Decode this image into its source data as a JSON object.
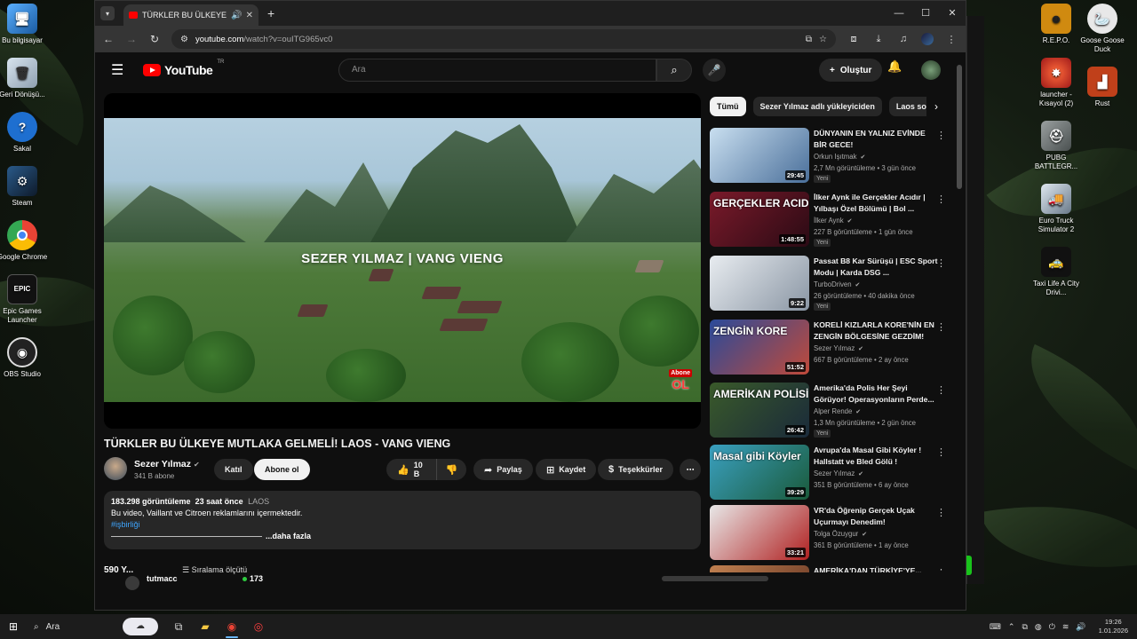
{
  "desktop": {
    "left_icons": [
      {
        "label": "Bu bilgisayar",
        "icon": "computer-icon"
      },
      {
        "label": "Geri Dönüşü...",
        "icon": "recycle-bin-icon"
      },
      {
        "label": "Sakal",
        "icon": "help-icon"
      },
      {
        "label": "Steam",
        "icon": "steam-icon"
      },
      {
        "label": "Google Chrome",
        "icon": "chrome-icon"
      },
      {
        "label": "Epic Games Launcher",
        "icon": "epic-games-icon"
      },
      {
        "label": "OBS Studio",
        "icon": "obs-icon"
      }
    ],
    "right_icons_a": [
      {
        "label": "R.E.P.O.",
        "icon": "repo-icon"
      },
      {
        "label": "launcher - Kısayol (2)",
        "icon": "launcher-icon"
      },
      {
        "label": "PUBG BATTLEGR...",
        "icon": "pubg-icon"
      },
      {
        "label": "Euro Truck Simulator 2",
        "icon": "truck-icon"
      },
      {
        "label": "Taxi Life A City Drivi...",
        "icon": "taxi-icon"
      }
    ],
    "right_icons_b": [
      {
        "label": "Goose Goose Duck",
        "icon": "goose-icon"
      },
      {
        "label": "Rust",
        "icon": "rust-icon"
      }
    ]
  },
  "browser": {
    "tab_title": "TÜRKLER BU ÜLKEYE MUTL...",
    "url_host": "youtube.com",
    "url_path": "/watch?v=ouITG965vc0",
    "new_tab": "+",
    "window_controls": {
      "minimize": "—",
      "maximize": "☐",
      "close": "✕"
    }
  },
  "youtube": {
    "logo_word": "YouTube",
    "logo_region": "TR",
    "search_placeholder": "Ara",
    "create_label": "Oluştur",
    "video": {
      "overlay_title": "SEZER YILMAZ | VANG VIENG",
      "overlay_badge_top": "Abone",
      "overlay_badge_bottom": "OL",
      "title": "TÜRKLER BU ÜLKEYE MUTLAKA GELMELİ! LAOS - VANG VIENG",
      "channel": "Sezer Yılmaz",
      "subscribers": "341 B abone",
      "join_label": "Katıl",
      "subscribe_label": "Abone ol",
      "likes": "10 B",
      "share_label": "Paylaş",
      "save_label": "Kaydet",
      "thanks_label": "Teşekkürler",
      "more_label": "⋯"
    },
    "description": {
      "views": "183.298 görüntüleme",
      "time": "23 saat önce",
      "location": "LAOS",
      "text": "Bu video, Vaillant ve Citroen reklamlarını içermektedir.",
      "hashtag": "#işbirliği",
      "more": "...daha fazla"
    },
    "comments": {
      "count": "590 Y...",
      "sort": "Sıralama ölçütü",
      "user": "tutmacc",
      "live_count": "173"
    },
    "chips": [
      "Tümü",
      "Sezer Yılmaz adlı yükleyiciden",
      "Laos so"
    ],
    "recommendations": [
      {
        "title": "DÜNYANIN EN YALNIZ EVİNDE BİR GECE!",
        "channel": "Orkun Işıtmak",
        "meta": "2,7 Mn görüntüleme • 3 gün önce",
        "badge": "Yeni",
        "duration": "29:45",
        "thumb_text": "",
        "color1": "#c9dff0",
        "color2": "#4a6f9a"
      },
      {
        "title": "İlker Aynk ile Gerçekler Acıdır | Yılbaşı Özel Bölümü | Bol ...",
        "channel": "İlker Aynk",
        "meta": "227 B görüntüleme • 1 gün önce",
        "badge": "Yeni",
        "duration": "1:48:55",
        "thumb_text": "GERÇEKLER ACIDIR",
        "color1": "#7a1a2a",
        "color2": "#2a0a14"
      },
      {
        "title": "Passat B8 Kar Sürüşü | ESC Sport Modu | Karda DSG ...",
        "channel": "TurboDriven",
        "meta": "26 görüntüleme • 40 dakika önce",
        "badge": "Yeni",
        "duration": "9:22",
        "thumb_text": "",
        "color1": "#e8ecf0",
        "color2": "#8a96a4"
      },
      {
        "title": "KORELİ KIZLARLA KORE'NİN EN ZENGİN BÖLGESİNE GEZDİM!",
        "channel": "Sezer Yılmaz",
        "meta": "667 B görüntüleme • 2 ay önce",
        "badge": "",
        "duration": "51:52",
        "thumb_text": "ZENGİN KORE",
        "color1": "#2a4a9a",
        "color2": "#c04a3a"
      },
      {
        "title": "Amerika'da Polis Her Şeyi Görüyor! Operasyonların Perde...",
        "channel": "Alper Rende",
        "meta": "1,3 Mn görüntüleme • 2 gün önce",
        "badge": "Yeni",
        "duration": "26:42",
        "thumb_text": "AMERİKAN POLİSİ",
        "color1": "#3a5a2a",
        "color2": "#1a2a3a"
      },
      {
        "title": "Avrupa'da Masal Gibi Köyler ! Hallstatt ve Bled Gölü !",
        "channel": "Sezer Yılmaz",
        "meta": "351 B görüntüleme • 6 ay önce",
        "badge": "",
        "duration": "39:29",
        "thumb_text": "Masal gibi Köyler",
        "color1": "#3aa0c0",
        "color2": "#1a5a3a"
      },
      {
        "title": "VR'da Öğrenip Gerçek Uçak Uçurmayı Denedim!",
        "channel": "Tolga Özuygur",
        "meta": "361 B görüntüleme • 1 ay önce",
        "badge": "",
        "duration": "33:21",
        "thumb_text": "",
        "color1": "#e8e8e8",
        "color2": "#b02020"
      },
      {
        "title": "AMERİKA'DAN TÜRKİYE'YE...",
        "channel": "",
        "meta": "",
        "badge": "",
        "duration": "",
        "thumb_text": "",
        "color1": "#c08050",
        "color2": "#603020"
      }
    ]
  },
  "taskbar": {
    "search_label": "Ara",
    "time": "19:26",
    "date": "1.01.2026"
  }
}
